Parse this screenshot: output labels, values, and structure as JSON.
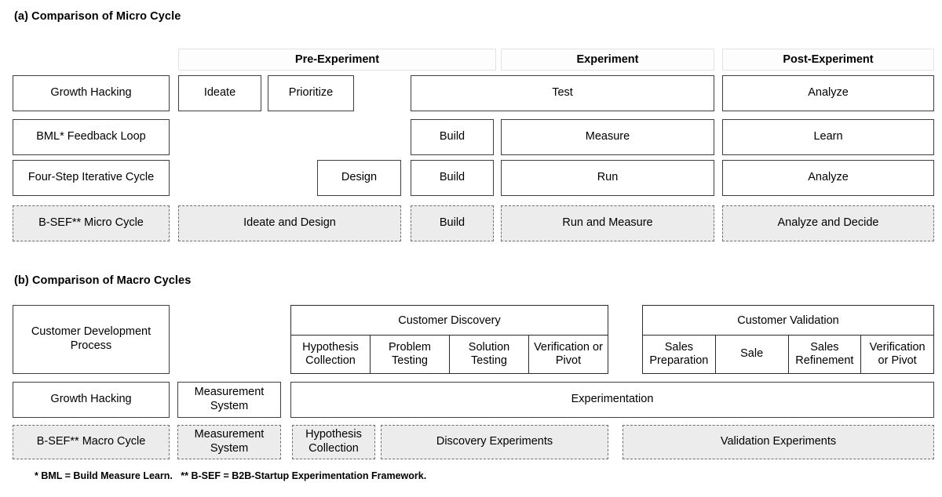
{
  "figure": {
    "section_a_title": "(a) Comparison of Micro Cycle",
    "section_b_title": "(b) Comparison of Macro Cycles",
    "footnote": "* BML = Build Measure Learn.   ** B-SEF = B2B-Startup Experimentation Framework.",
    "colors": {
      "highlight_fill": "#ececec",
      "box_border": "#3f3f3f",
      "dashed_border": "#6f6f6f",
      "header_fill": "#fdfdfd"
    }
  },
  "micro": {
    "phase_headers": [
      {
        "label": "Pre-Experiment"
      },
      {
        "label": "Experiment"
      },
      {
        "label": "Post-Experiment"
      }
    ],
    "rows": [
      {
        "name": "Growth Hacking",
        "cells": [
          {
            "label": "Ideate"
          },
          {
            "label": "Prioritize"
          },
          {
            "label": "Test"
          },
          {
            "label": "Analyze"
          }
        ]
      },
      {
        "name": "BML* Feedback Loop",
        "cells": [
          {
            "label": "Build"
          },
          {
            "label": "Measure"
          },
          {
            "label": "Learn"
          }
        ]
      },
      {
        "name": "Four-Step Iterative Cycle",
        "cells": [
          {
            "label": "Design"
          },
          {
            "label": "Build"
          },
          {
            "label": "Run"
          },
          {
            "label": "Analyze"
          }
        ]
      },
      {
        "name": "B-SEF** Micro Cycle",
        "cells": [
          {
            "label": "Ideate and Design"
          },
          {
            "label": "Build"
          },
          {
            "label": "Run and Measure"
          },
          {
            "label": "Analyze and Decide"
          }
        ]
      }
    ]
  },
  "macro": {
    "rows": [
      {
        "name": "Customer Development Process",
        "groups": [
          {
            "title": "Customer Discovery",
            "cells": [
              "Hypothesis Collection",
              "Problem Testing",
              "Solution Testing",
              "Verification or Pivot"
            ]
          },
          {
            "title": "Customer Validation",
            "cells": [
              "Sales Preparation",
              "Sale",
              "Sales Refinement",
              "Verification or Pivot"
            ]
          }
        ]
      },
      {
        "name": "Growth Hacking",
        "cells": [
          {
            "label": "Measurement System"
          },
          {
            "label": "Experimentation"
          }
        ]
      },
      {
        "name": "B-SEF** Macro Cycle",
        "cells": [
          {
            "label": "Measurement System"
          },
          {
            "label": "Hypothesis Collection"
          },
          {
            "label": "Discovery Experiments"
          },
          {
            "label": "Validation Experiments"
          }
        ]
      }
    ]
  }
}
